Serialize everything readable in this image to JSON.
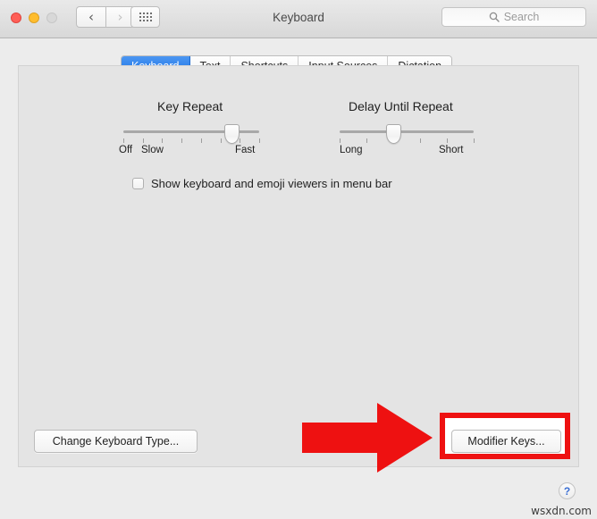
{
  "window": {
    "title": "Keyboard",
    "traffic_lights": [
      "close-red",
      "minimize-yellow",
      "zoom-disabled-gray"
    ],
    "nav": {
      "back_icon": "chevron-left-icon",
      "forward_icon": "chevron-right-icon",
      "grid_icon": "show-all-grid-icon"
    },
    "search": {
      "placeholder": "Search",
      "value": "",
      "icon": "search-icon"
    }
  },
  "tabs": [
    {
      "label": "Keyboard",
      "active": true
    },
    {
      "label": "Text",
      "active": false
    },
    {
      "label": "Shortcuts",
      "active": false
    },
    {
      "label": "Input Sources",
      "active": false
    },
    {
      "label": "Dictation",
      "active": false
    }
  ],
  "sliders": {
    "key_repeat": {
      "title": "Key Repeat",
      "min_label": "Off",
      "second_label": "Slow",
      "max_label": "Fast",
      "ticks": 8,
      "value_percent": 80
    },
    "delay_until_repeat": {
      "title": "Delay Until Repeat",
      "min_label": "Long",
      "max_label": "Short",
      "ticks": 6,
      "value_percent": 40
    }
  },
  "checkbox": {
    "label": "Show keyboard and emoji viewers in menu bar",
    "checked": false
  },
  "buttons": {
    "change_keyboard_type": "Change Keyboard Type...",
    "modifier_keys": "Modifier Keys...",
    "help": "?"
  },
  "annotation": {
    "arrow_color": "#ee1111",
    "highlight_color": "#ee1111",
    "target": "Modifier Keys..."
  },
  "watermark": "wsxdn.com",
  "colors": {
    "window_background": "#ececec",
    "panel_background": "#e4e4e4",
    "active_tab_blue": "#1b6fe4",
    "annotation_red": "#ee1111",
    "help_blue": "#3b6fd4"
  }
}
